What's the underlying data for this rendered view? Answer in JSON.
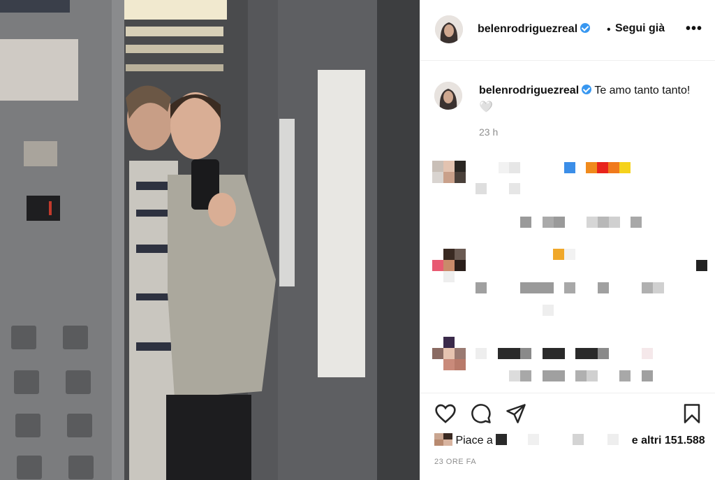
{
  "header": {
    "username": "belenrodriguezreal",
    "verified_icon": "verified-badge-icon",
    "separator": "•",
    "follow_label": "Segui già",
    "more_label": "•••"
  },
  "caption": {
    "username": "belenrodriguezreal",
    "text": "Te amo tanto tanto! 🤍",
    "time": "23 h"
  },
  "actions": {
    "like_icon": "heart-icon",
    "comment_icon": "comment-icon",
    "share_icon": "paper-plane-icon",
    "save_icon": "bookmark-icon"
  },
  "likes": {
    "prefix": "Piace a",
    "suffix": "e altri 151.588"
  },
  "timestamp": "23 ORE FA",
  "colors": {
    "verified": "#3897f0",
    "secondary_text": "#8e8e8e",
    "border": "#efefef"
  }
}
